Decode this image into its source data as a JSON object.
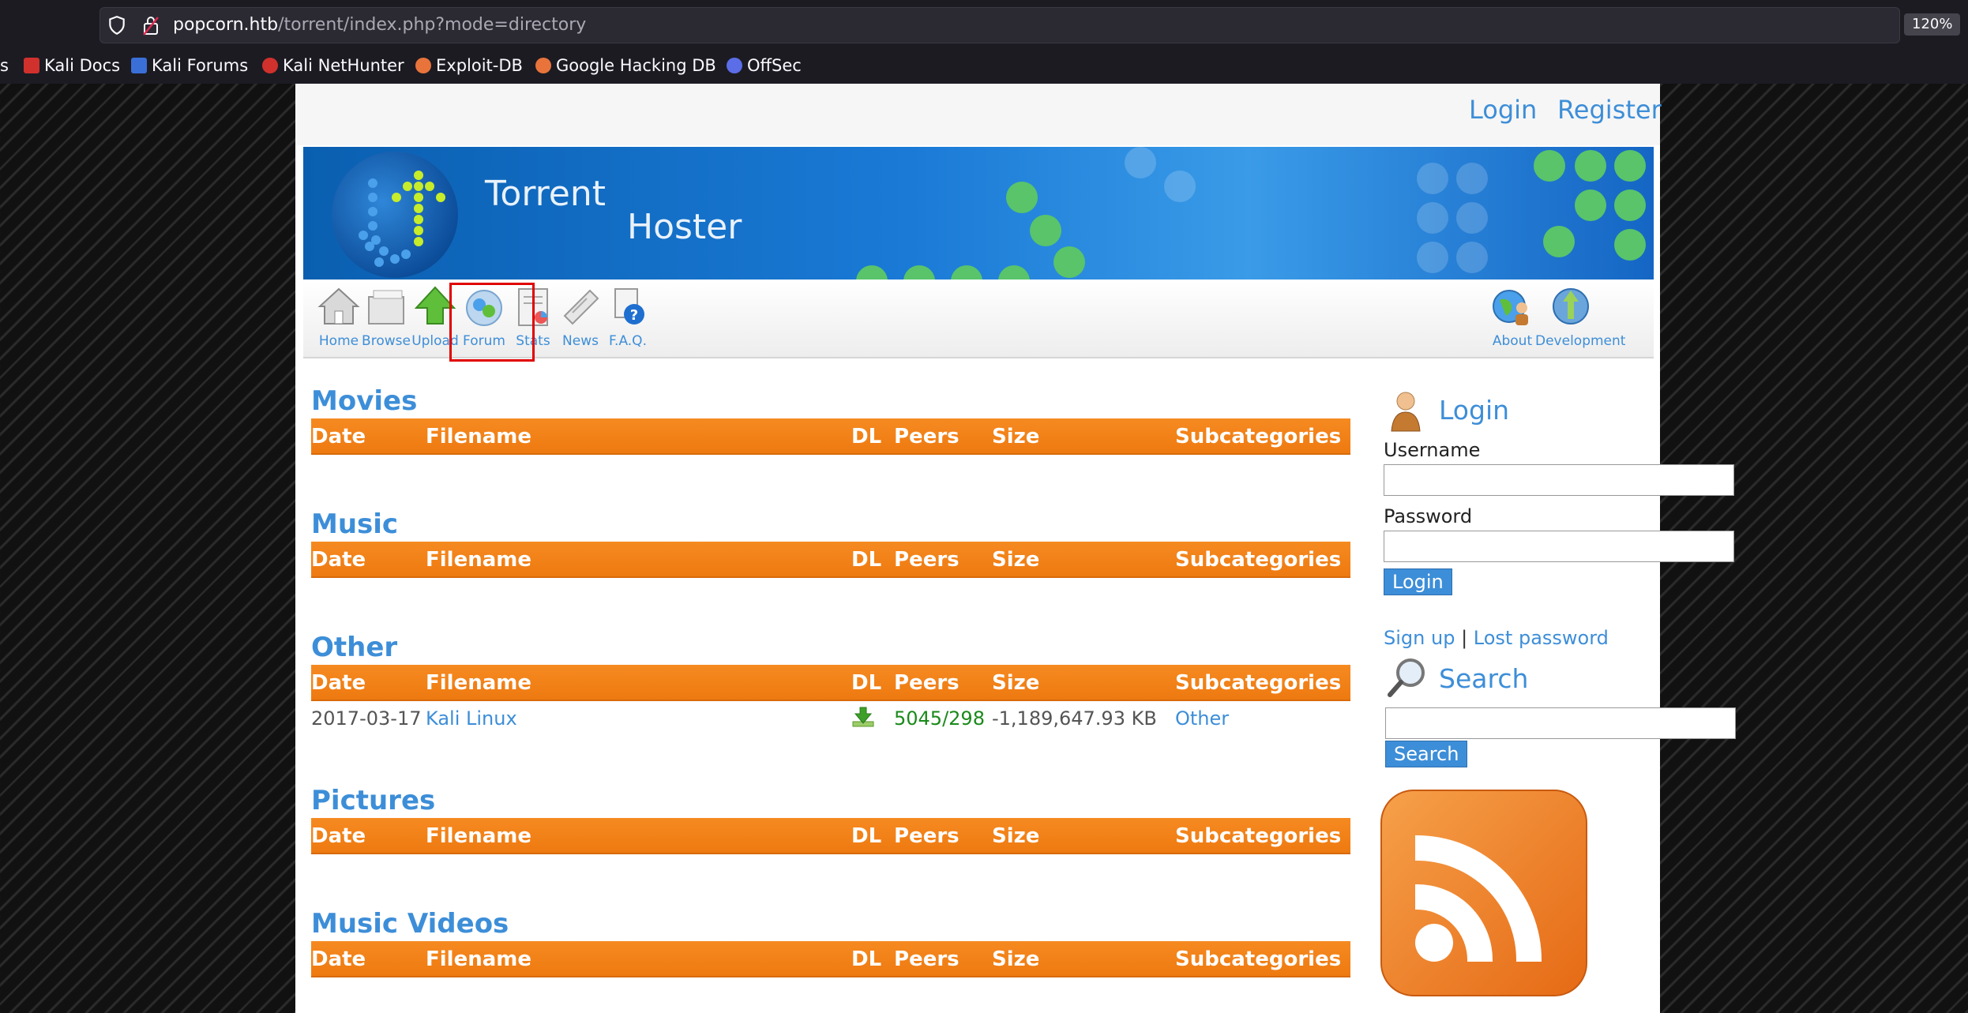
{
  "browser": {
    "url_host": "popcorn.htb",
    "url_path": "/torrent/index.php?mode=directory",
    "zoom": "120%",
    "bookmarks": [
      {
        "label": "s",
        "icon": "bookmark-fragment-icon",
        "color": "#1c1b22"
      },
      {
        "label": "Kali Docs",
        "icon": "kali-docs-icon",
        "color": "#d0312d"
      },
      {
        "label": "Kali Forums",
        "icon": "kali-forums-icon",
        "color": "#3a6fd8"
      },
      {
        "label": "Kali NetHunter",
        "icon": "kali-nethunter-icon",
        "color": "#d0312d"
      },
      {
        "label": "Exploit-DB",
        "icon": "exploit-db-icon",
        "color": "#e8743b"
      },
      {
        "label": "Google Hacking DB",
        "icon": "ghdb-icon",
        "color": "#e8743b"
      },
      {
        "label": "OffSec",
        "icon": "offsec-icon",
        "color": "#5b6ee8"
      }
    ]
  },
  "header": {
    "login_link": "Login",
    "register_link": "Register",
    "brand_line1": "Torrent",
    "brand_line2": "Hoster"
  },
  "nav": {
    "items": [
      {
        "label": "Home",
        "icon": "home-icon"
      },
      {
        "label": "Browse",
        "icon": "browse-icon"
      },
      {
        "label": "Upload",
        "icon": "upload-arrow-icon"
      },
      {
        "label": "Forum",
        "icon": "forum-icon"
      },
      {
        "label": "Stats",
        "icon": "stats-icon"
      },
      {
        "label": "News",
        "icon": "news-icon"
      },
      {
        "label": "F.A.Q.",
        "icon": "faq-icon"
      },
      {
        "label": "About",
        "icon": "about-icon"
      },
      {
        "label": "Development",
        "icon": "development-icon"
      }
    ]
  },
  "columns": {
    "date": "Date",
    "filename": "Filename",
    "dl": "DL",
    "peers": "Peers",
    "size": "Size",
    "subcategories": "Subcategories"
  },
  "categories": [
    {
      "title": "Movies",
      "rows": []
    },
    {
      "title": "Music",
      "rows": []
    },
    {
      "title": "Other",
      "rows": [
        {
          "date": "2017-03-17",
          "filename": "Kali Linux",
          "peers": "5045/298",
          "size": "-1,189,647.93 KB",
          "subcategory": "Other"
        }
      ]
    },
    {
      "title": "Pictures",
      "rows": []
    },
    {
      "title": "Music Videos",
      "rows": []
    }
  ],
  "sidebar": {
    "login_title": "Login",
    "username_label": "Username",
    "password_label": "Password",
    "login_button": "Login",
    "signup_link": "Sign up",
    "separator": "|",
    "lost_password_link": "Lost password",
    "search_title": "Search",
    "search_button": "Search"
  },
  "colors": {
    "accent": "#3d8ed8",
    "header_orange": "#f58a21",
    "peers_green": "#1a8a1a"
  }
}
